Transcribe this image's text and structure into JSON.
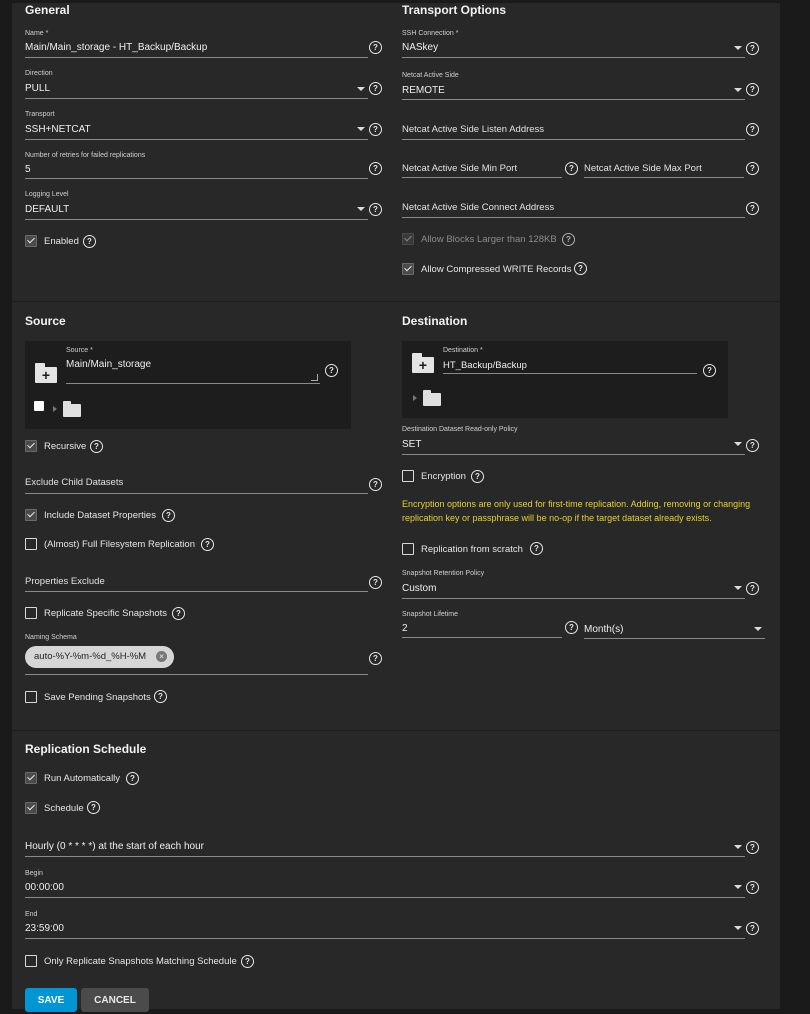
{
  "general": {
    "title": "General",
    "name": {
      "label": "Name *",
      "value": "Main/Main_storage - HT_Backup/Backup"
    },
    "direction": {
      "label": "Direction",
      "value": "PULL"
    },
    "transport": {
      "label": "Transport",
      "value": "SSH+NETCAT"
    },
    "retries": {
      "label": "Number of retries for failed replications",
      "value": "5"
    },
    "logging": {
      "label": "Logging Level",
      "value": "DEFAULT"
    },
    "enabled": {
      "label": "Enabled",
      "checked": true
    }
  },
  "transport": {
    "title": "Transport Options",
    "ssh": {
      "label": "SSH Connection *",
      "value": "NASkey"
    },
    "active_side": {
      "label": "Netcat Active Side",
      "value": "REMOTE"
    },
    "listen_address": {
      "placeholder": "Netcat Active Side Listen Address"
    },
    "min_port": {
      "placeholder": "Netcat Active Side Min Port"
    },
    "max_port": {
      "placeholder": "Netcat Active Side Max Port"
    },
    "connect_address": {
      "placeholder": "Netcat Active Side Connect Address"
    },
    "large_blocks": {
      "label": "Allow Blocks Larger than 128KB",
      "checked": true,
      "disabled": true
    },
    "compressed": {
      "label": "Allow Compressed WRITE Records",
      "checked": true
    }
  },
  "source": {
    "title": "Source",
    "field": {
      "label": "Source *",
      "value": "Main/Main_storage"
    },
    "recursive": {
      "label": "Recursive",
      "checked": true
    },
    "exclude_child": {
      "placeholder": "Exclude Child Datasets"
    },
    "include_props": {
      "label": "Include Dataset Properties",
      "checked": true
    },
    "full_fs": {
      "label": "(Almost) Full Filesystem Replication",
      "checked": false
    },
    "props_exclude": {
      "placeholder": "Properties Exclude"
    },
    "specific_snapshots": {
      "label": "Replicate Specific Snapshots",
      "checked": false
    },
    "naming_schema": {
      "label": "Naming Schema",
      "chip": "auto-%Y-%m-%d_%H-%M",
      "remove": "×"
    },
    "save_pending": {
      "label": "Save Pending Snapshots",
      "checked": false
    }
  },
  "destination": {
    "title": "Destination",
    "field": {
      "label": "Destination *",
      "value": "HT_Backup/Backup"
    },
    "readonly_policy": {
      "label": "Destination Dataset Read-only Policy",
      "value": "SET"
    },
    "encryption": {
      "label": "Encryption",
      "checked": false
    },
    "note": "Encryption options are only used for first-time replication. Adding, removing or changing replication key or passphrase will be no-op if the target dataset already exists.",
    "from_scratch": {
      "label": "Replication from scratch",
      "checked": false
    },
    "retention": {
      "label": "Snapshot Retention Policy",
      "value": "Custom"
    },
    "lifetime": {
      "label": "Snapshot Lifetime",
      "value": "2",
      "unit": "Month(s)"
    }
  },
  "schedule": {
    "title": "Replication Schedule",
    "run_auto": {
      "label": "Run Automatically",
      "checked": true
    },
    "schedule": {
      "label": "Schedule",
      "checked": true
    },
    "preset": {
      "value": "Hourly (0 * * * *) at the start of each hour"
    },
    "begin": {
      "label": "Begin",
      "value": "00:00:00"
    },
    "end": {
      "label": "End",
      "value": "23:59:00"
    },
    "only_matching": {
      "label": "Only Replicate Snapshots Matching Schedule",
      "checked": false
    }
  },
  "actions": {
    "save": "SAVE",
    "cancel": "CANCEL"
  },
  "icons": {
    "help": "help-circle-icon",
    "folder": "folder-icon",
    "add_folder": "folder-plus-icon",
    "check": "check-icon",
    "caret": "caret-down-icon",
    "clear": "close-circle-icon"
  },
  "colors": {
    "accent": "#0095d5",
    "warning_text": "#e5d22e",
    "panel": "#282828",
    "background": "#1a1a1a"
  }
}
